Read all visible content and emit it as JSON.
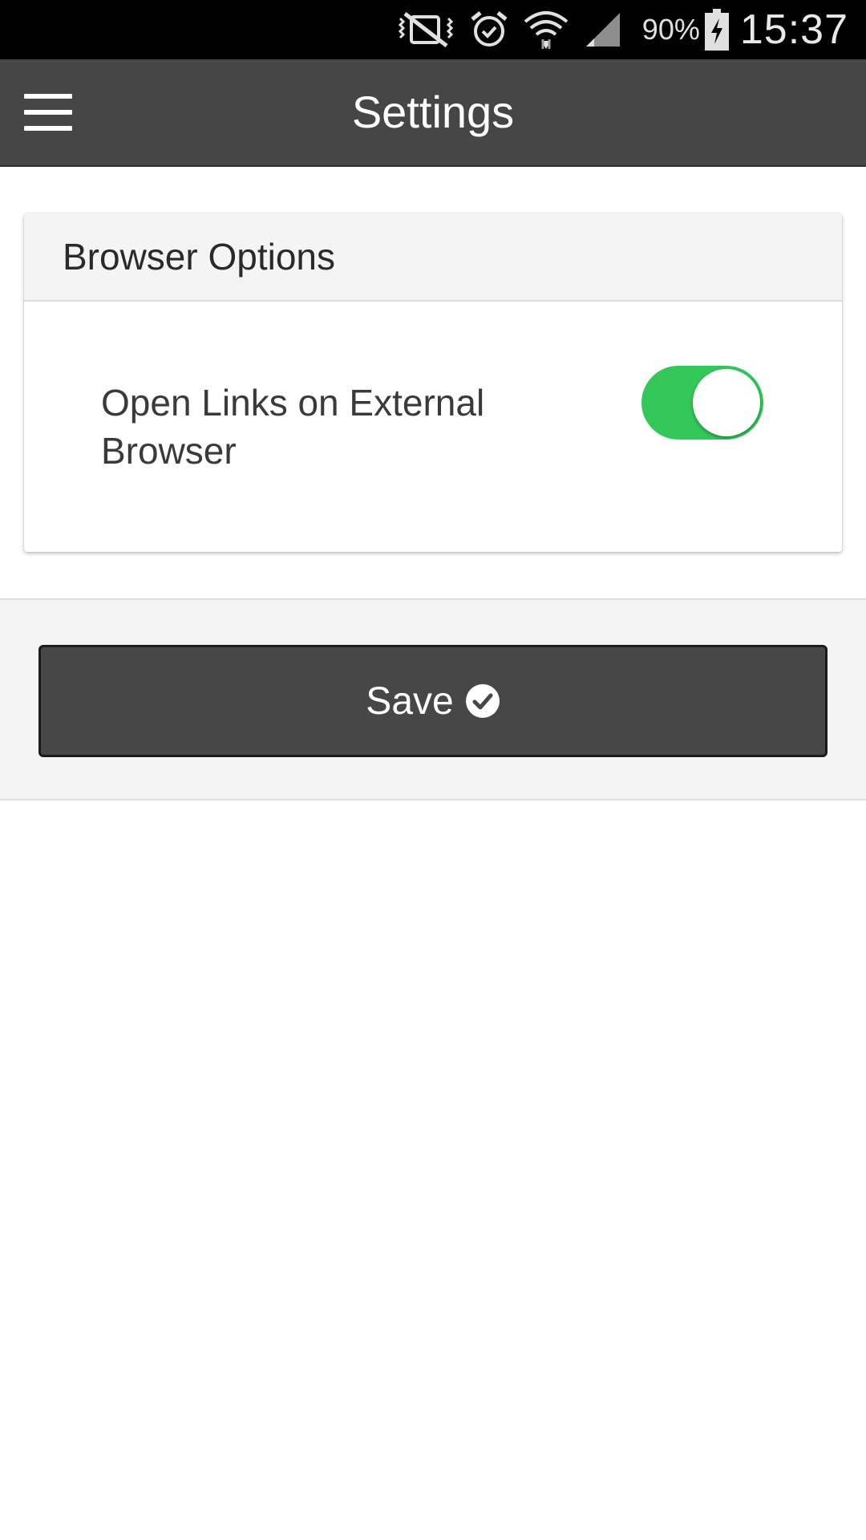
{
  "status_bar": {
    "battery_percent": "90%",
    "time": "15:37",
    "icons": [
      "mute-vibrate-icon",
      "alarm-icon",
      "wifi-icon",
      "signal-icon",
      "battery-charging-icon"
    ]
  },
  "app_bar": {
    "title": "Settings",
    "menu_icon": "hamburger-menu-icon"
  },
  "browser_options": {
    "header": "Browser Options",
    "open_links_label": "Open Links on External Browser",
    "open_links_enabled": true
  },
  "save": {
    "label": "Save",
    "icon": "check-circle-icon"
  },
  "colors": {
    "app_bar": "#464646",
    "toggle_on": "#34c75a",
    "button": "#474747"
  }
}
